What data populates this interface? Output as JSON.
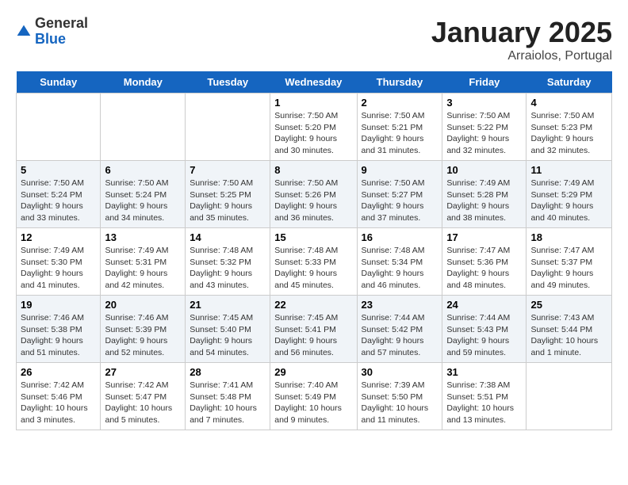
{
  "header": {
    "logo_general": "General",
    "logo_blue": "Blue",
    "month_title": "January 2025",
    "subtitle": "Arraiolos, Portugal"
  },
  "days_of_week": [
    "Sunday",
    "Monday",
    "Tuesday",
    "Wednesday",
    "Thursday",
    "Friday",
    "Saturday"
  ],
  "weeks": [
    [
      {
        "day": "",
        "content": ""
      },
      {
        "day": "",
        "content": ""
      },
      {
        "day": "",
        "content": ""
      },
      {
        "day": "1",
        "content": "Sunrise: 7:50 AM\nSunset: 5:20 PM\nDaylight: 9 hours\nand 30 minutes."
      },
      {
        "day": "2",
        "content": "Sunrise: 7:50 AM\nSunset: 5:21 PM\nDaylight: 9 hours\nand 31 minutes."
      },
      {
        "day": "3",
        "content": "Sunrise: 7:50 AM\nSunset: 5:22 PM\nDaylight: 9 hours\nand 32 minutes."
      },
      {
        "day": "4",
        "content": "Sunrise: 7:50 AM\nSunset: 5:23 PM\nDaylight: 9 hours\nand 32 minutes."
      }
    ],
    [
      {
        "day": "5",
        "content": "Sunrise: 7:50 AM\nSunset: 5:24 PM\nDaylight: 9 hours\nand 33 minutes."
      },
      {
        "day": "6",
        "content": "Sunrise: 7:50 AM\nSunset: 5:24 PM\nDaylight: 9 hours\nand 34 minutes."
      },
      {
        "day": "7",
        "content": "Sunrise: 7:50 AM\nSunset: 5:25 PM\nDaylight: 9 hours\nand 35 minutes."
      },
      {
        "day": "8",
        "content": "Sunrise: 7:50 AM\nSunset: 5:26 PM\nDaylight: 9 hours\nand 36 minutes."
      },
      {
        "day": "9",
        "content": "Sunrise: 7:50 AM\nSunset: 5:27 PM\nDaylight: 9 hours\nand 37 minutes."
      },
      {
        "day": "10",
        "content": "Sunrise: 7:49 AM\nSunset: 5:28 PM\nDaylight: 9 hours\nand 38 minutes."
      },
      {
        "day": "11",
        "content": "Sunrise: 7:49 AM\nSunset: 5:29 PM\nDaylight: 9 hours\nand 40 minutes."
      }
    ],
    [
      {
        "day": "12",
        "content": "Sunrise: 7:49 AM\nSunset: 5:30 PM\nDaylight: 9 hours\nand 41 minutes."
      },
      {
        "day": "13",
        "content": "Sunrise: 7:49 AM\nSunset: 5:31 PM\nDaylight: 9 hours\nand 42 minutes."
      },
      {
        "day": "14",
        "content": "Sunrise: 7:48 AM\nSunset: 5:32 PM\nDaylight: 9 hours\nand 43 minutes."
      },
      {
        "day": "15",
        "content": "Sunrise: 7:48 AM\nSunset: 5:33 PM\nDaylight: 9 hours\nand 45 minutes."
      },
      {
        "day": "16",
        "content": "Sunrise: 7:48 AM\nSunset: 5:34 PM\nDaylight: 9 hours\nand 46 minutes."
      },
      {
        "day": "17",
        "content": "Sunrise: 7:47 AM\nSunset: 5:36 PM\nDaylight: 9 hours\nand 48 minutes."
      },
      {
        "day": "18",
        "content": "Sunrise: 7:47 AM\nSunset: 5:37 PM\nDaylight: 9 hours\nand 49 minutes."
      }
    ],
    [
      {
        "day": "19",
        "content": "Sunrise: 7:46 AM\nSunset: 5:38 PM\nDaylight: 9 hours\nand 51 minutes."
      },
      {
        "day": "20",
        "content": "Sunrise: 7:46 AM\nSunset: 5:39 PM\nDaylight: 9 hours\nand 52 minutes."
      },
      {
        "day": "21",
        "content": "Sunrise: 7:45 AM\nSunset: 5:40 PM\nDaylight: 9 hours\nand 54 minutes."
      },
      {
        "day": "22",
        "content": "Sunrise: 7:45 AM\nSunset: 5:41 PM\nDaylight: 9 hours\nand 56 minutes."
      },
      {
        "day": "23",
        "content": "Sunrise: 7:44 AM\nSunset: 5:42 PM\nDaylight: 9 hours\nand 57 minutes."
      },
      {
        "day": "24",
        "content": "Sunrise: 7:44 AM\nSunset: 5:43 PM\nDaylight: 9 hours\nand 59 minutes."
      },
      {
        "day": "25",
        "content": "Sunrise: 7:43 AM\nSunset: 5:44 PM\nDaylight: 10 hours\nand 1 minute."
      }
    ],
    [
      {
        "day": "26",
        "content": "Sunrise: 7:42 AM\nSunset: 5:46 PM\nDaylight: 10 hours\nand 3 minutes."
      },
      {
        "day": "27",
        "content": "Sunrise: 7:42 AM\nSunset: 5:47 PM\nDaylight: 10 hours\nand 5 minutes."
      },
      {
        "day": "28",
        "content": "Sunrise: 7:41 AM\nSunset: 5:48 PM\nDaylight: 10 hours\nand 7 minutes."
      },
      {
        "day": "29",
        "content": "Sunrise: 7:40 AM\nSunset: 5:49 PM\nDaylight: 10 hours\nand 9 minutes."
      },
      {
        "day": "30",
        "content": "Sunrise: 7:39 AM\nSunset: 5:50 PM\nDaylight: 10 hours\nand 11 minutes."
      },
      {
        "day": "31",
        "content": "Sunrise: 7:38 AM\nSunset: 5:51 PM\nDaylight: 10 hours\nand 13 minutes."
      },
      {
        "day": "",
        "content": ""
      }
    ]
  ]
}
